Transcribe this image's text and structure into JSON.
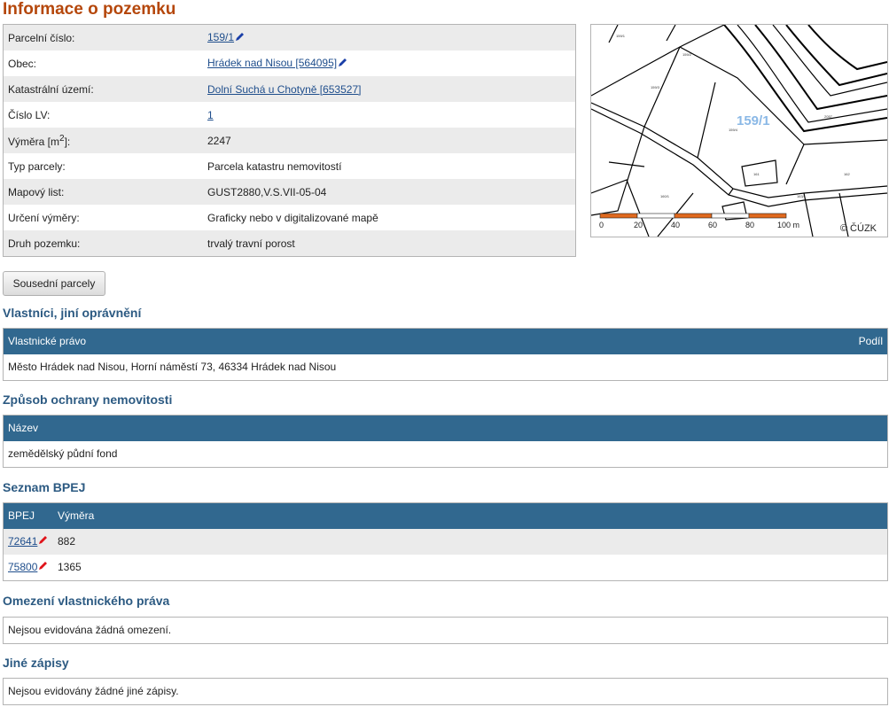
{
  "page_title": "Informace o pozemku",
  "info": [
    {
      "key": "Parcelní číslo:",
      "value": "159/1",
      "link": true,
      "edit_icon": true
    },
    {
      "key": "Obec:",
      "value": "Hrádek nad Nisou [564095]",
      "link": true,
      "edit_icon": true
    },
    {
      "key": "Katastrální území:",
      "value": "Dolní Suchá u Chotyně [653527]",
      "link": true,
      "edit_icon": false
    },
    {
      "key": "Číslo LV:",
      "value": "1",
      "link": true,
      "edit_icon": false
    },
    {
      "key_main": "Výměra [m",
      "key_sup": "2",
      "key_end": "]:",
      "value": "2247",
      "link": false,
      "edit_icon": false
    },
    {
      "key": "Typ parcely:",
      "value": "Parcela katastru nemovitostí",
      "link": false,
      "edit_icon": false
    },
    {
      "key": "Mapový list:",
      "value": "GUST2880,V.S.VII-05-04",
      "link": false,
      "edit_icon": false
    },
    {
      "key": "Určení výměry:",
      "value": "Graficky nebo v digitalizované mapě",
      "link": false,
      "edit_icon": false
    },
    {
      "key": "Druh pozemku:",
      "value": "trvalý travní porost",
      "link": false,
      "edit_icon": false
    }
  ],
  "map": {
    "parcel_label": "159/1",
    "scale_ticks": [
      "0",
      "20",
      "40",
      "60",
      "80",
      "100 m"
    ],
    "copyright": "© ČÚZK",
    "scale_colors": [
      "#e0691e",
      "#ffffff"
    ]
  },
  "neighbors_button": "Sousední parcely",
  "owners": {
    "title": "Vlastníci, jiní oprávnění",
    "header_left": "Vlastnické právo",
    "header_right": "Podíl",
    "rows": [
      "Město Hrádek nad Nisou, Horní náměstí 73, 46334 Hrádek nad Nisou"
    ]
  },
  "protection": {
    "title": "Způsob ochrany nemovitosti",
    "header": "Název",
    "rows": [
      "zemědělský půdní fond"
    ]
  },
  "bpej": {
    "title": "Seznam BPEJ",
    "col1": "BPEJ",
    "col2": "Výměra",
    "rows": [
      {
        "code": "72641",
        "area": "882"
      },
      {
        "code": "75800",
        "area": "1365"
      }
    ]
  },
  "restrictions": {
    "title": "Omezení vlastnického práva",
    "text": "Nejsou evidována žádná omezení."
  },
  "other": {
    "title": "Jiné zápisy",
    "text": "Nejsou evidovány žádné jiné zápisy."
  },
  "colors": {
    "title": "#b5470b",
    "section": "#2c5a82",
    "header_bg": "#31688f",
    "link": "#1f4e8c",
    "edit_icon_red": "#e0141b",
    "edit_icon_blue": "#1a3fa8"
  }
}
